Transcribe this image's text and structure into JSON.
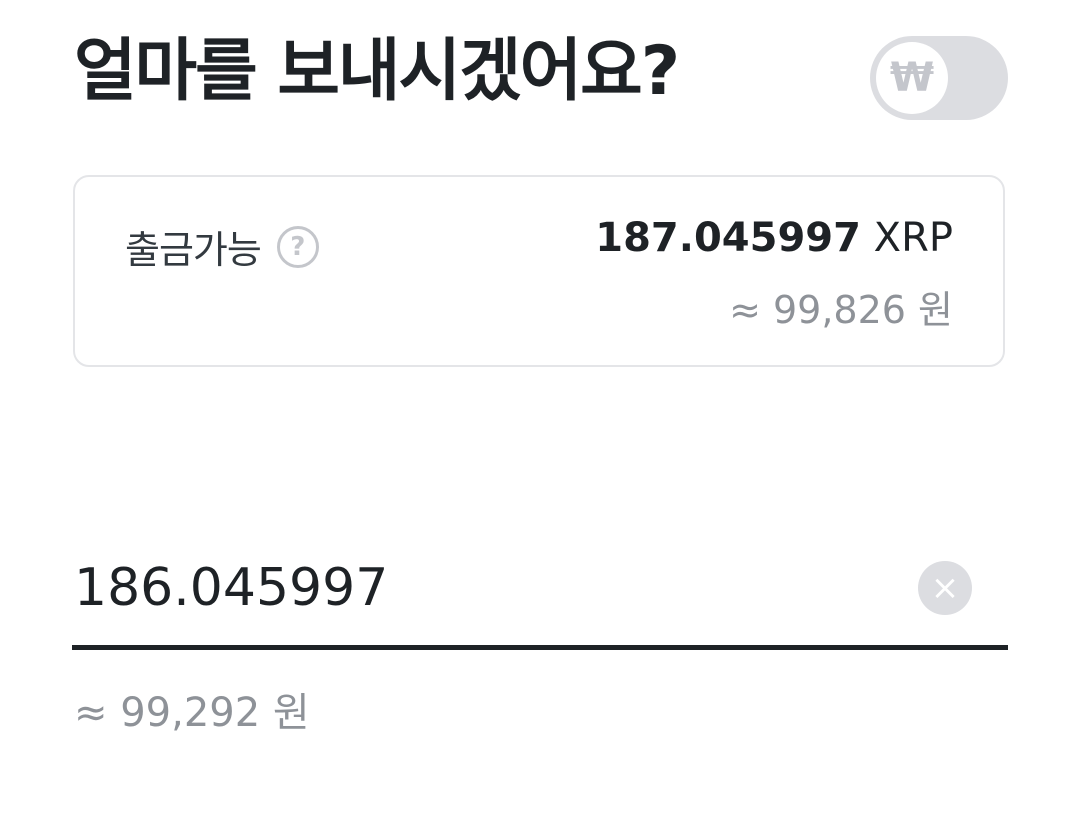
{
  "header": {
    "title": "얼마를 보내시겠어요?",
    "currency_toggle_symbol": "₩",
    "currency_toggle_on": false
  },
  "balance": {
    "label": "출금가능",
    "help_symbol": "?",
    "amount": "187.045997",
    "unit": "XRP",
    "krw_equivalent": "≈ 99,826 원"
  },
  "amount_input": {
    "value": "186.045997",
    "clear_symbol": "×",
    "krw_equivalent": "≈ 99,292 원"
  },
  "colors": {
    "text_primary": "#1e2226",
    "text_secondary": "#8e9298",
    "toggle_off": "#dcdde1",
    "card_border": "#e4e5e8"
  }
}
